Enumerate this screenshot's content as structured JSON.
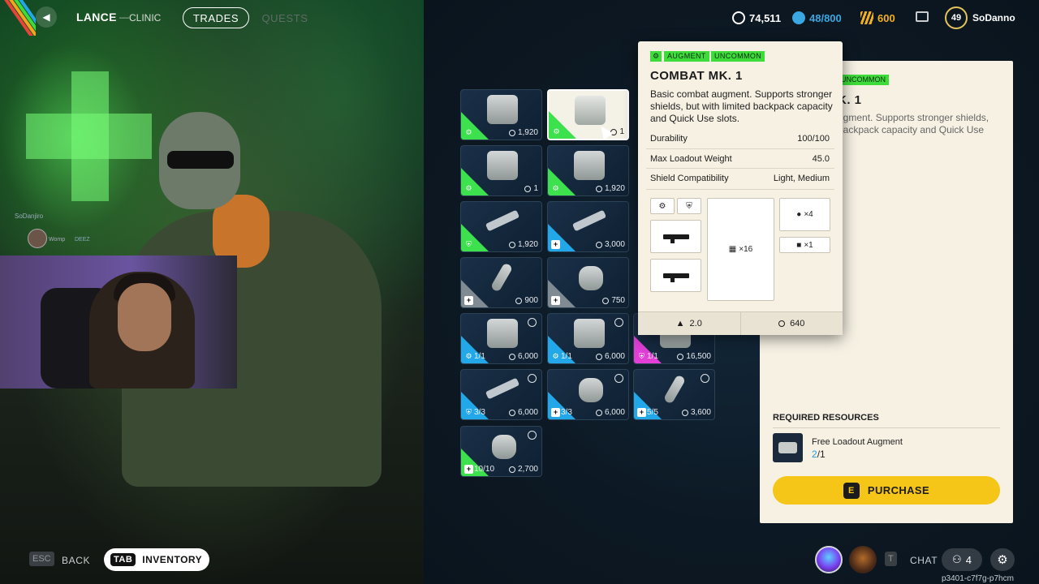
{
  "header": {
    "trader_name": "LANCE",
    "trader_dash": "—",
    "trader_sub": "CLINIC",
    "tabs": [
      {
        "label": "TRADES",
        "active": true
      },
      {
        "label": "QUESTS",
        "active": false
      }
    ],
    "wallet": {
      "coins": "74,511",
      "cred": "48/800",
      "tokens": "600"
    },
    "level": "49",
    "username": "SoDanno"
  },
  "stream_overlay": {
    "chat_user": "SoDanjiro",
    "chat_line_a": "Womp",
    "chat_line_b": "DEEZ"
  },
  "grid": {
    "items": [
      {
        "col": 0,
        "row": 0,
        "rarity": "green",
        "icon": "augment-icon",
        "qty": "",
        "price": "1,920",
        "img": "box"
      },
      {
        "col": 1,
        "row": 0,
        "rarity": "green",
        "icon": "augment-icon",
        "qty": "",
        "price": "1",
        "img": "box",
        "selected": true
      },
      {
        "col": 0,
        "row": 1,
        "rarity": "green",
        "icon": "augment-icon",
        "qty": "",
        "price": "1",
        "img": "box"
      },
      {
        "col": 1,
        "row": 1,
        "rarity": "green",
        "icon": "augment-icon",
        "qty": "",
        "price": "1,920",
        "img": "box"
      },
      {
        "col": 0,
        "row": 2,
        "rarity": "green",
        "icon": "shield-icon",
        "qty": "",
        "price": "1,920",
        "img": "gun"
      },
      {
        "col": 1,
        "row": 2,
        "rarity": "blue",
        "icon": "plus-icon",
        "qty": "",
        "price": "3,000",
        "img": "gun"
      },
      {
        "col": 0,
        "row": 3,
        "rarity": "gray",
        "icon": "plus-icon",
        "qty": "",
        "price": "900",
        "img": "tube"
      },
      {
        "col": 1,
        "row": 3,
        "rarity": "gray",
        "icon": "plus-icon",
        "qty": "",
        "price": "750",
        "img": "wrap"
      },
      {
        "col": 0,
        "row": 4,
        "rarity": "blue",
        "icon": "augment-icon",
        "qty": "1/1",
        "price": "6,000",
        "img": "box",
        "timer": true
      },
      {
        "col": 1,
        "row": 4,
        "rarity": "blue",
        "icon": "augment-icon",
        "qty": "1/1",
        "price": "6,000",
        "img": "box",
        "timer": true
      },
      {
        "col": 2,
        "row": 4,
        "rarity": "pink",
        "icon": "shield-icon",
        "qty": "1/1",
        "price": "16,500",
        "img": "box",
        "timer": true
      },
      {
        "col": 0,
        "row": 5,
        "rarity": "blue",
        "icon": "shield-icon",
        "qty": "3/3",
        "price": "6,000",
        "img": "gun",
        "timer": true
      },
      {
        "col": 1,
        "row": 5,
        "rarity": "blue",
        "icon": "plus-icon",
        "qty": "3/3",
        "price": "6,000",
        "img": "wrap",
        "timer": true
      },
      {
        "col": 2,
        "row": 5,
        "rarity": "blue",
        "icon": "plus-icon",
        "qty": "5/5",
        "price": "3,600",
        "img": "tube",
        "timer": true
      },
      {
        "col": 0,
        "row": 6,
        "rarity": "green",
        "icon": "plus-icon",
        "qty": "10/10",
        "price": "2,700",
        "img": "wrap",
        "timer": true
      }
    ]
  },
  "tooltip": {
    "badge_type": "AUGMENT",
    "badge_rarity": "UNCOMMON",
    "title": "COMBAT MK. 1",
    "description": "Basic combat augment. Supports stronger shields, but with limited backpack capacity and Quick Use slots.",
    "stats": [
      {
        "label": "Durability",
        "value": "100/100"
      },
      {
        "label": "Max Loadout Weight",
        "value": "45.0"
      },
      {
        "label": "Shield Compatibility",
        "value": "Light, Medium"
      }
    ],
    "slots": {
      "backpack": "×16",
      "quick_use": "×4",
      "safe_pocket": "×1"
    },
    "weight": "2.0",
    "value": "640"
  },
  "panel": {
    "badge": "UNCOMMON",
    "title_partial": "K. 1",
    "desc_partial": "ugment. Supports stronger shields, backpack capacity and Quick Use",
    "required_heading": "REQUIRED RESOURCES",
    "req_item_name": "Free Loadout Augment",
    "req_have": "2",
    "req_need": "/1",
    "purchase_key": "E",
    "purchase_label": "PURCHASE"
  },
  "footer": {
    "esc_key": "ESC",
    "back_label": "BACK",
    "tab_key": "TAB",
    "inventory_label": "INVENTORY",
    "chat_key": "T",
    "chat_label": "CHAT",
    "party_count": "4",
    "session_id": "p3401-c7f7g-p7hcm"
  },
  "colors": {
    "uncommon_green": "#3ddc3b",
    "rare_blue": "#22a8e8",
    "epic_pink": "#e13fd6",
    "purchase_yellow": "#f5c518",
    "cred_blue": "#3aa7e0",
    "token_gold": "#f2b01e"
  }
}
